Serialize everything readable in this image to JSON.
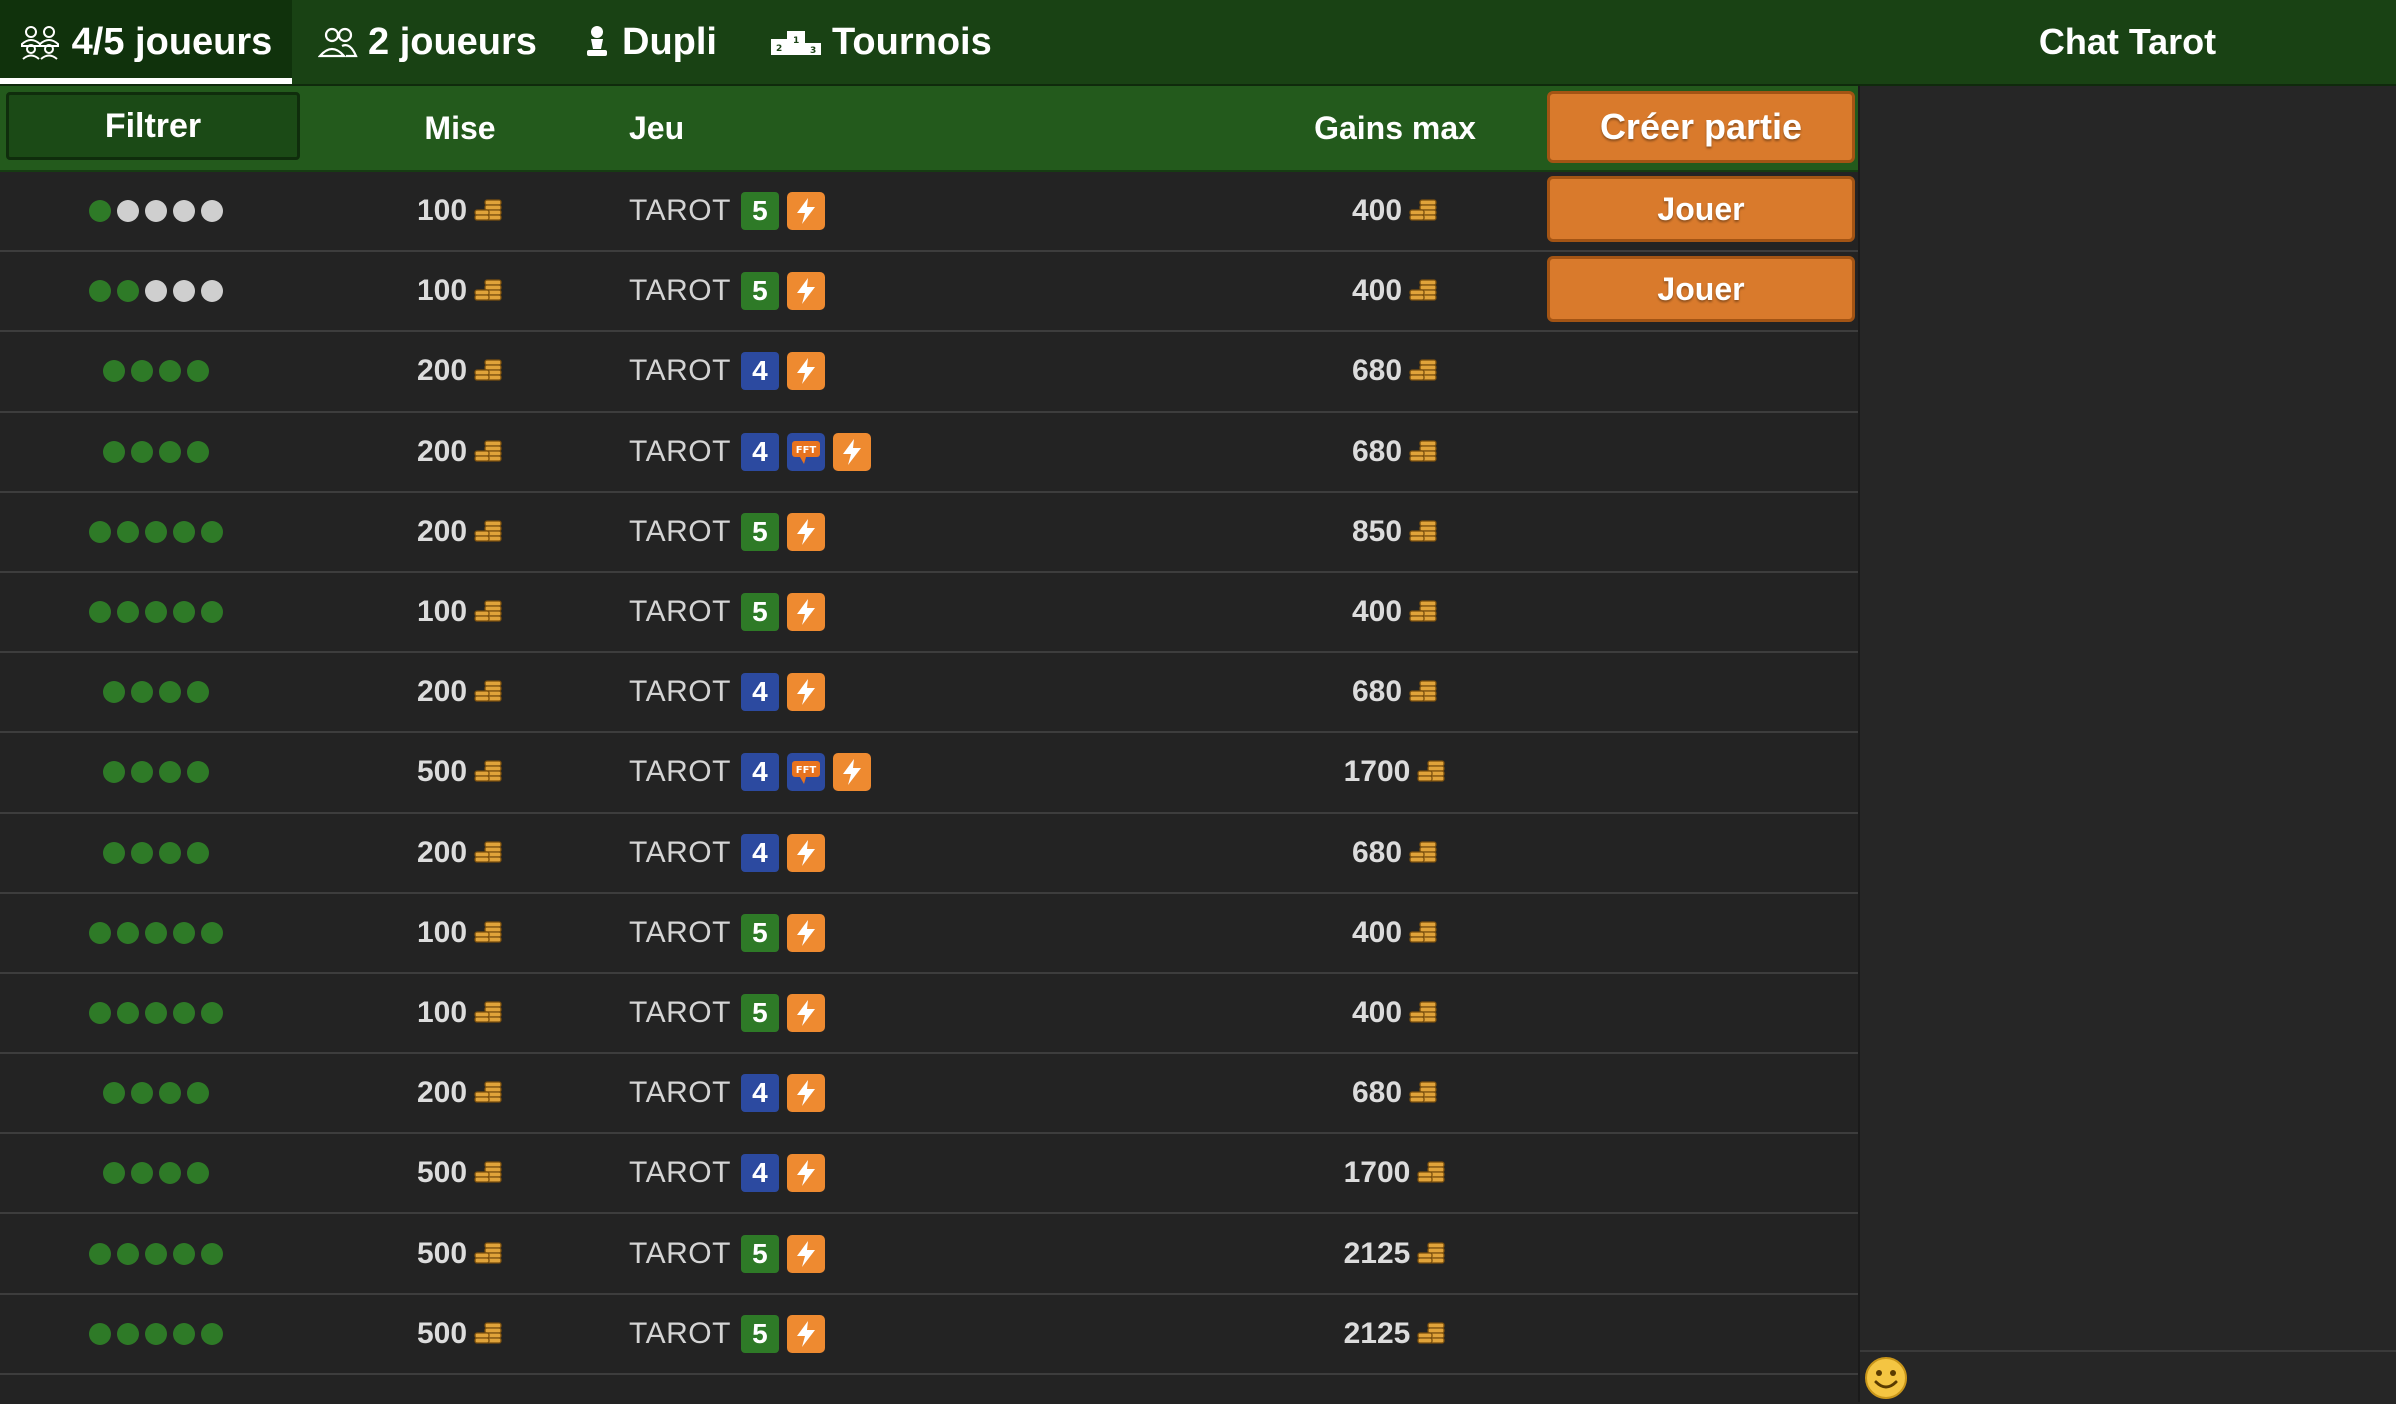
{
  "nav": {
    "tabs": [
      {
        "label": "4/5 joueurs",
        "icon": "multi-players-icon",
        "active": true
      },
      {
        "label": "2 joueurs",
        "icon": "two-players-icon",
        "active": false
      },
      {
        "label": "Dupli",
        "icon": "pawn-icon",
        "active": false
      },
      {
        "label": "Tournois",
        "icon": "podium-icon",
        "active": false
      }
    ],
    "chat_title": "Chat Tarot"
  },
  "header": {
    "filter_label": "Filtrer",
    "mise_label": "Mise",
    "jeu_label": "Jeu",
    "gains_label": "Gains max",
    "create_label": "Créer partie"
  },
  "colors": {
    "seat_filled": "#2e7a27",
    "seat_empty": "#cfcfcf",
    "accent": "#d97a2c"
  },
  "rows": [
    {
      "seats": 5,
      "filled": 1,
      "mise": "100",
      "game": "TAROT",
      "players": "5",
      "fft": false,
      "gains": "400",
      "action": "Jouer"
    },
    {
      "seats": 5,
      "filled": 2,
      "mise": "100",
      "game": "TAROT",
      "players": "5",
      "fft": false,
      "gains": "400",
      "action": "Jouer"
    },
    {
      "seats": 4,
      "filled": 4,
      "mise": "200",
      "game": "TAROT",
      "players": "4",
      "fft": false,
      "gains": "680",
      "action": ""
    },
    {
      "seats": 4,
      "filled": 4,
      "mise": "200",
      "game": "TAROT",
      "players": "4",
      "fft": true,
      "gains": "680",
      "action": ""
    },
    {
      "seats": 5,
      "filled": 5,
      "mise": "200",
      "game": "TAROT",
      "players": "5",
      "fft": false,
      "gains": "850",
      "action": ""
    },
    {
      "seats": 5,
      "filled": 5,
      "mise": "100",
      "game": "TAROT",
      "players": "5",
      "fft": false,
      "gains": "400",
      "action": ""
    },
    {
      "seats": 4,
      "filled": 4,
      "mise": "200",
      "game": "TAROT",
      "players": "4",
      "fft": false,
      "gains": "680",
      "action": ""
    },
    {
      "seats": 4,
      "filled": 4,
      "mise": "500",
      "game": "TAROT",
      "players": "4",
      "fft": true,
      "gains": "1700",
      "action": ""
    },
    {
      "seats": 4,
      "filled": 4,
      "mise": "200",
      "game": "TAROT",
      "players": "4",
      "fft": false,
      "gains": "680",
      "action": ""
    },
    {
      "seats": 5,
      "filled": 5,
      "mise": "100",
      "game": "TAROT",
      "players": "5",
      "fft": false,
      "gains": "400",
      "action": ""
    },
    {
      "seats": 5,
      "filled": 5,
      "mise": "100",
      "game": "TAROT",
      "players": "5",
      "fft": false,
      "gains": "400",
      "action": ""
    },
    {
      "seats": 4,
      "filled": 4,
      "mise": "200",
      "game": "TAROT",
      "players": "4",
      "fft": false,
      "gains": "680",
      "action": ""
    },
    {
      "seats": 4,
      "filled": 4,
      "mise": "500",
      "game": "TAROT",
      "players": "4",
      "fft": false,
      "gains": "1700",
      "action": ""
    },
    {
      "seats": 5,
      "filled": 5,
      "mise": "500",
      "game": "TAROT",
      "players": "5",
      "fft": false,
      "gains": "2125",
      "action": ""
    },
    {
      "seats": 5,
      "filled": 5,
      "mise": "500",
      "game": "TAROT",
      "players": "5",
      "fft": false,
      "gains": "2125",
      "action": ""
    }
  ],
  "chat": {
    "emoji_icon": "smiley-icon"
  }
}
